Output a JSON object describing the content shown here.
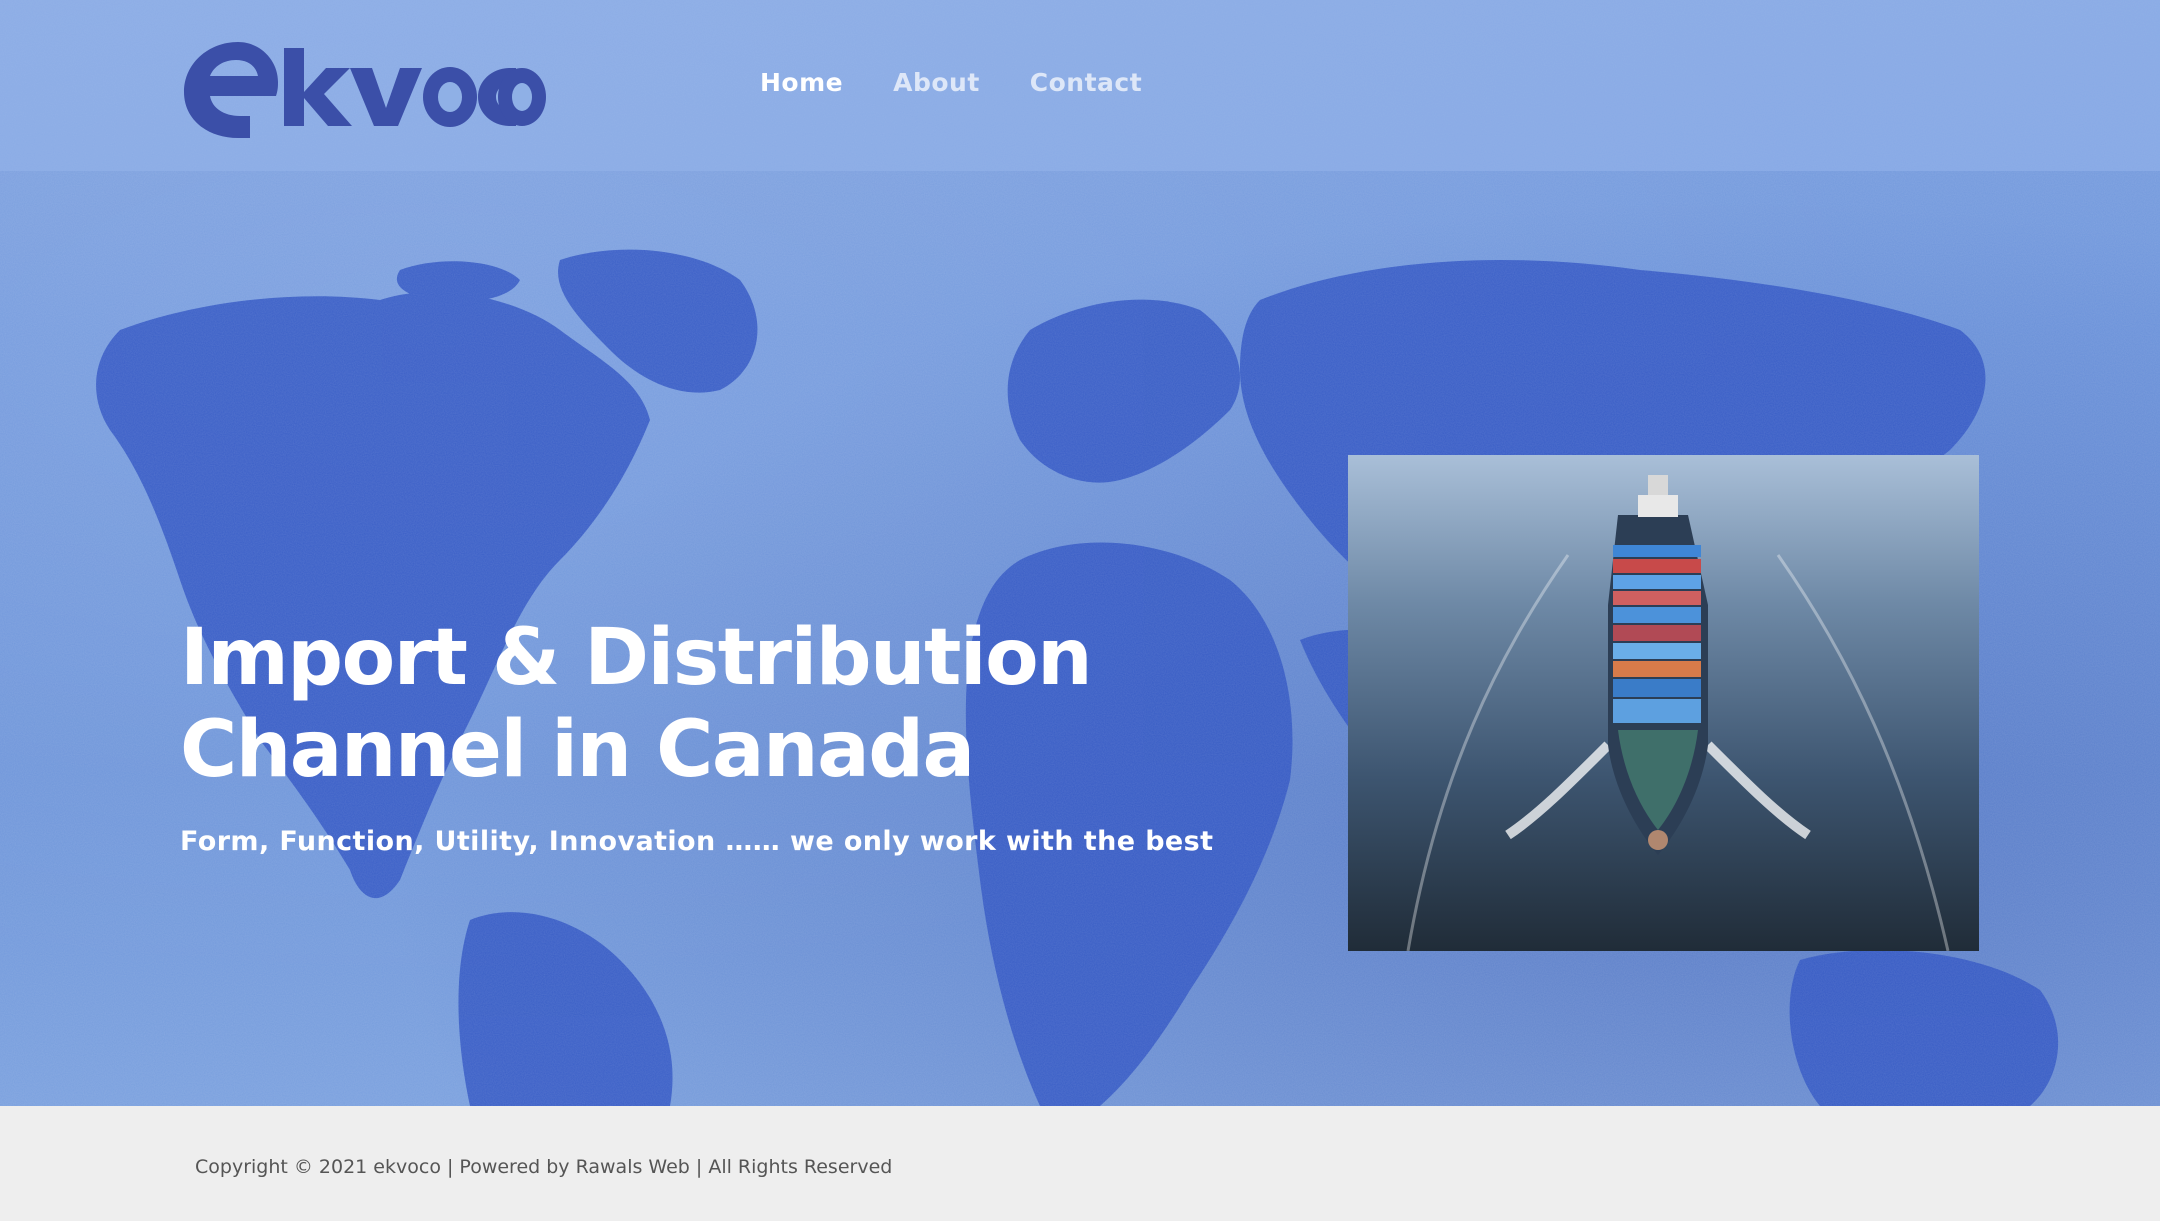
{
  "header": {
    "logo_text": "ekvoco",
    "nav": [
      {
        "label": "Home",
        "active": true
      },
      {
        "label": "About",
        "active": false
      },
      {
        "label": "Contact",
        "active": false
      }
    ]
  },
  "hero": {
    "title_line1": "Import & Distribution",
    "title_line2": "Channel in Canada",
    "subtitle": "Form, Function, Utility, Innovation …… we only work with the best"
  },
  "footer": {
    "copyright": "Copyright © 2021 ekvoco | Powered by Rawals Web | All Rights Reserved"
  },
  "colors": {
    "logo": "#3b4fa8",
    "map_land": "#2e4fbf",
    "hero_bg": "#6d95dc",
    "footer_bg": "#eeeeee"
  },
  "icons": {
    "hero_image": "cargo-ship-photo",
    "background": "world-map-wall"
  }
}
